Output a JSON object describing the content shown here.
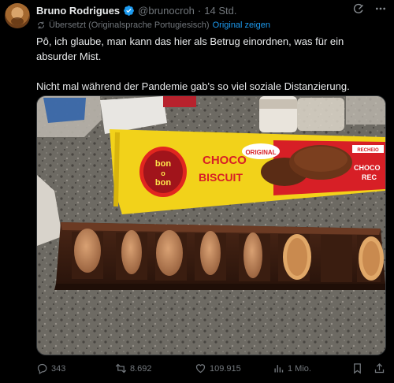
{
  "tweet": {
    "author_name": "Bruno Rodrigues",
    "handle": "@brunocroh",
    "separator": "·",
    "time": "14 Std.",
    "translation_note": "Übersetzt (Originalsprache Portugiesisch)",
    "show_original_label": "Original zeigen",
    "text_lines": [
      "Pô, ich glaube, man kann das hier als Betrug einordnen, was für ein absurder Mist.",
      "Nicht mal während der Pandemie gab's so viel soziale Distanzierung."
    ],
    "image": {
      "brand_top": "bon",
      "brand_mid": "o",
      "brand_bottom": "bon",
      "product_line1": "CHOCO",
      "product_line2": "BISCUIT",
      "badge": "ORIGINAL",
      "side_text": "CHOCO",
      "side_text2": "REC",
      "tag": "RECHEIO"
    },
    "stats": {
      "replies": "343",
      "reposts": "8.692",
      "likes": "109.915",
      "views": "1 Mio."
    }
  },
  "colors": {
    "background": "#000000",
    "text": "#e7e9ea",
    "muted": "#71767b",
    "accent": "#1d9bf0"
  },
  "icons": {
    "verified": "verified-badge-icon",
    "grok": "grok-icon",
    "more": "more-icon",
    "translate": "translate-icon",
    "reply": "reply-icon",
    "repost": "repost-icon",
    "like": "heart-icon",
    "views": "views-icon",
    "bookmark": "bookmark-icon",
    "share": "share-icon"
  }
}
